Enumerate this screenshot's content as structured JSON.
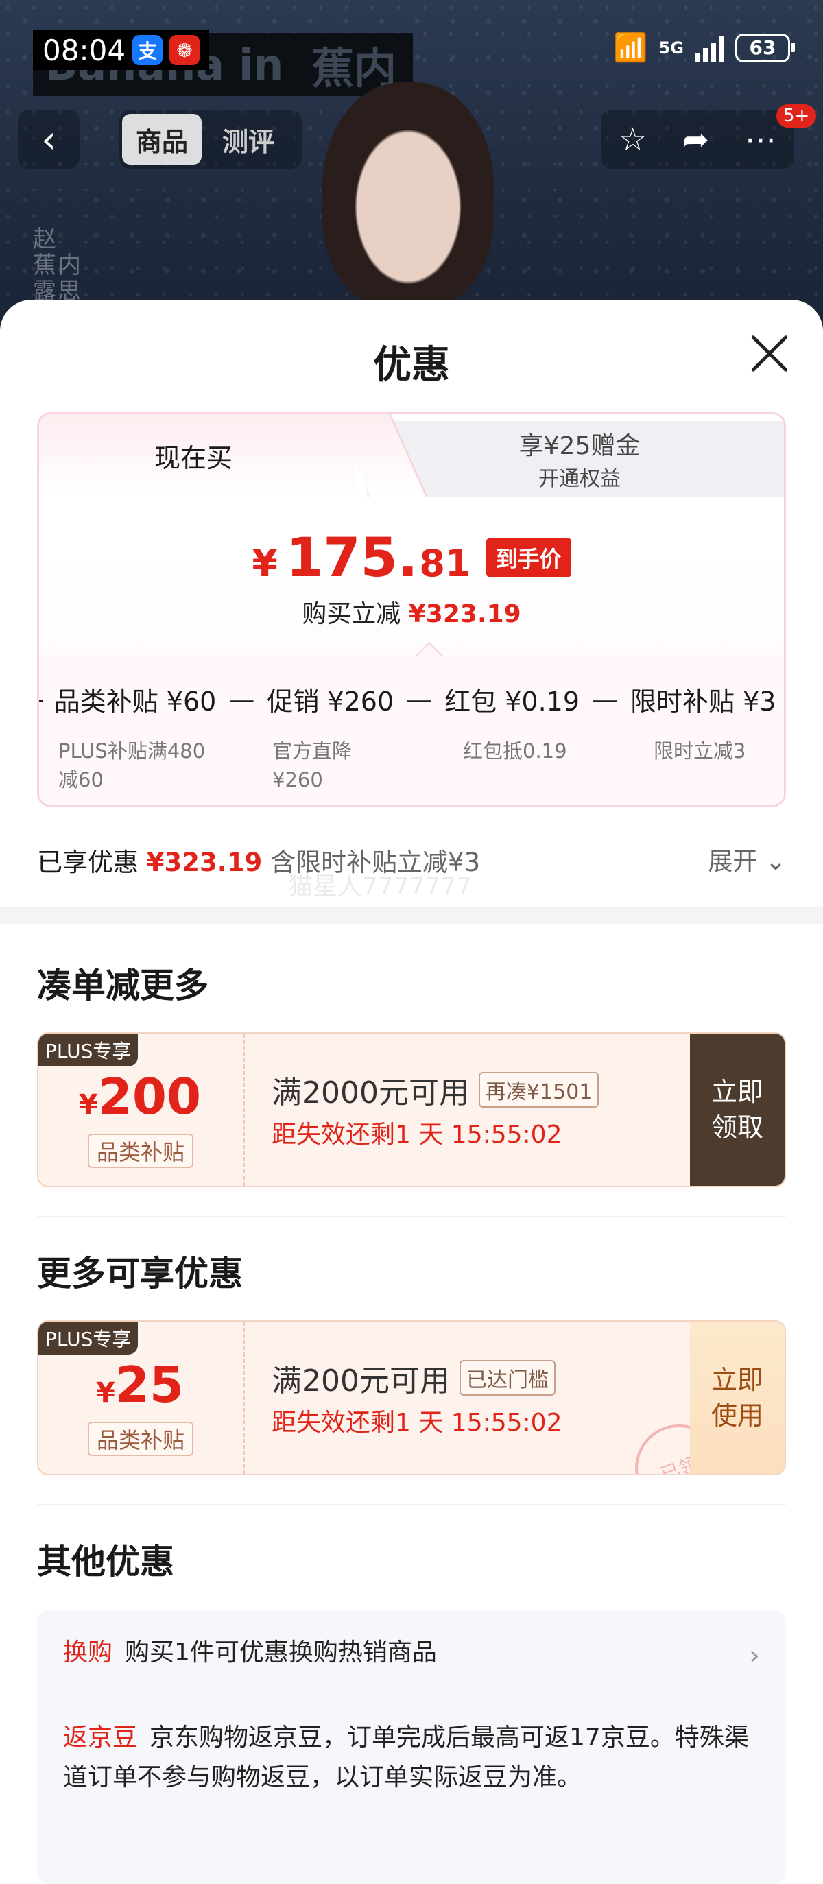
{
  "status_bar": {
    "time": "08:04",
    "network": "5G",
    "battery": "63"
  },
  "banner": {
    "brand1": "Banana",
    "brand2": "in",
    "brand3": "蕉内",
    "side_text": "赵 蕉内 露思品"
  },
  "nav": {
    "back": "‹",
    "tabs": [
      "商品",
      "测评"
    ],
    "badge": "5+"
  },
  "sheet": {
    "title": "优惠",
    "tabs": {
      "now": "现在买",
      "plus_line1": "享¥25赠金",
      "plus_line2": "开通权益"
    },
    "price": {
      "yen": "¥",
      "int": "175.",
      "dec": "81",
      "tag": "到手价"
    },
    "save": {
      "label": "购买立减",
      "amount": "¥323.19"
    },
    "breakdown": [
      {
        "label": "品类补贴 ¥60",
        "sub": "PLUS补贴满480减60"
      },
      {
        "label": "促销 ¥260",
        "sub": "官方直降¥260"
      },
      {
        "label": "红包 ¥0.19",
        "sub": "红包抵0.19"
      },
      {
        "label": "限时补贴 ¥3",
        "sub": "限时立减3"
      }
    ],
    "enjoyed": {
      "label": "已享优惠",
      "amount": "¥323.19",
      "note": "含限时补贴立减¥3",
      "expand": "展开"
    },
    "watermark": "猫星人7777777"
  },
  "section_more": {
    "title": "凑单减更多",
    "coupon": {
      "tag": "PLUS专享",
      "yen": "¥",
      "amount": "200",
      "category": "品类补贴",
      "condition": "满2000元可用",
      "pill": "再凑¥1501",
      "countdown": "距失效还剩1 天 15:55:02",
      "button": "立即领取"
    }
  },
  "section_available": {
    "title": "更多可享优惠",
    "coupon": {
      "tag": "PLUS专享",
      "yen": "¥",
      "amount": "25",
      "category": "品类补贴",
      "condition": "满200元可用",
      "pill": "已达门槛",
      "countdown": "距失效还剩1 天 15:55:02",
      "button": "立即使用",
      "stamp": "已领"
    }
  },
  "section_other": {
    "title": "其他优惠",
    "items": [
      {
        "tag": "换购",
        "text": "购买1件可优惠换购热销商品"
      },
      {
        "tag": "返京豆",
        "text": "京东购物返京豆，订单完成后最高可返17京豆。特殊渠道订单不参与购物返豆，以订单实际返豆为准。"
      }
    ]
  },
  "colors": {
    "accent": "#e2231a",
    "plus_dark": "#4d3b2e",
    "coupon_bg": "#fdf2ec"
  }
}
